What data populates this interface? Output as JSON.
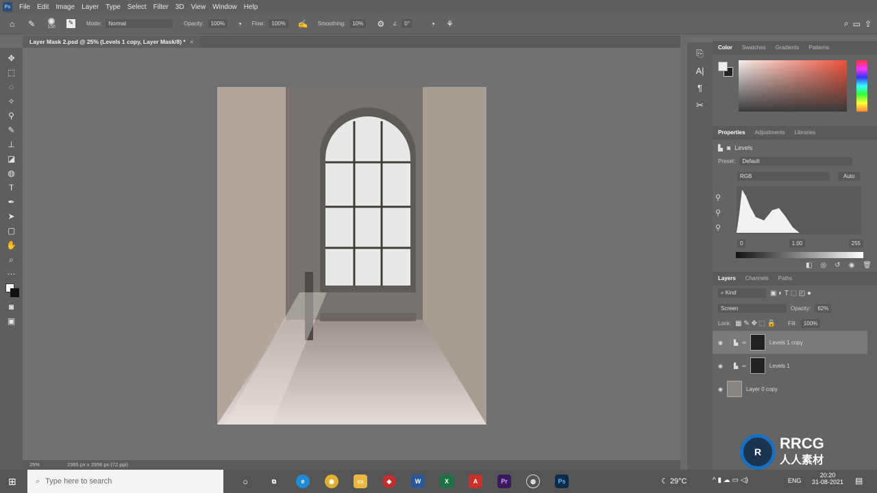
{
  "menu": [
    "File",
    "Edit",
    "Image",
    "Layer",
    "Type",
    "Select",
    "Filter",
    "3D",
    "View",
    "Window",
    "Help"
  ],
  "app_logo": "Ps",
  "options": {
    "brush_size": "156",
    "mode_label": "Mode:",
    "mode": "Normal",
    "opacity_label": "Opacity:",
    "opacity": "100%",
    "flow_label": "Flow:",
    "flow": "100%",
    "smoothing_label": "Smoothing:",
    "smoothing": "10%",
    "angle": "0°"
  },
  "document_tab": "Layer Mask 2.psd @ 25% (Levels 1 copy, Layer Mask/8) *",
  "status": {
    "zoom": "25%",
    "doc_info": "2365 px x 2956 px (72 ppi)"
  },
  "color_panel": {
    "tabs": [
      "Color",
      "Swatches",
      "Gradients",
      "Patterns"
    ]
  },
  "properties_panel": {
    "tabs": [
      "Properties",
      "Adjustments",
      "Libraries"
    ],
    "type": "Levels",
    "preset_label": "Preset:",
    "preset": "Default",
    "channel": "RGB",
    "auto": "Auto",
    "input_black": "0",
    "input_gamma": "1.00",
    "input_white": "255"
  },
  "layers_panel": {
    "tabs": [
      "Layers",
      "Channels",
      "Paths"
    ],
    "filter": "Kind",
    "blend_mode": "Screen",
    "opacity_label": "Opacity:",
    "opacity": "62%",
    "lock_label": "Lock:",
    "fill_label": "Fill:",
    "fill": "100%",
    "layers": [
      {
        "name": "Levels 1 copy",
        "selected": true
      },
      {
        "name": "Levels 1",
        "selected": false
      },
      {
        "name": "Layer 0 copy",
        "selected": false
      }
    ]
  },
  "taskbar": {
    "search_placeholder": "Type here to search",
    "weather": "29°C",
    "lang": "ENG",
    "time": "20:20",
    "date": "31-08-2021"
  },
  "watermark": "RRCG 人人素材"
}
